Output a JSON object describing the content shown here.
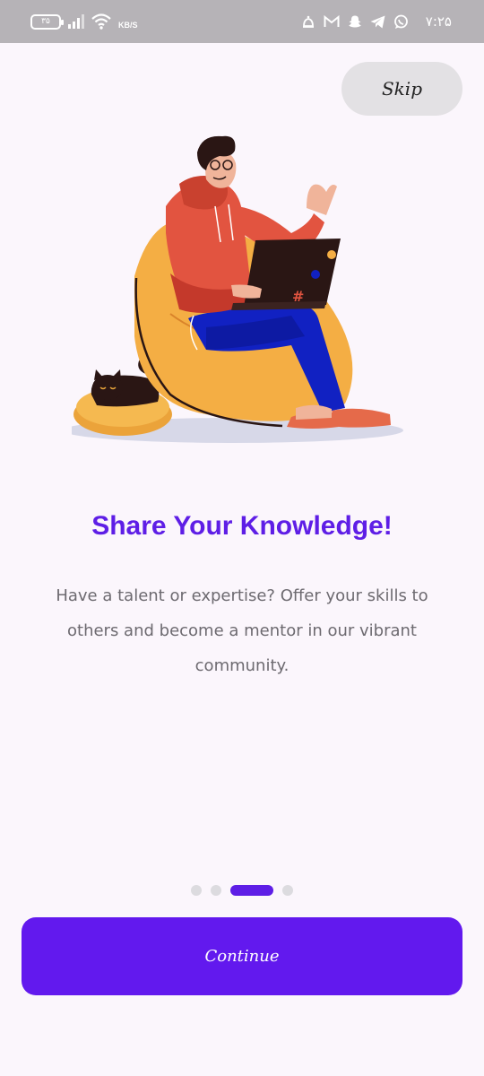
{
  "status_bar": {
    "battery_level": "۳۵",
    "net_speed": "KB/S",
    "time": "۷:۲۵",
    "icons": [
      "battery-icon",
      "signal-icon",
      "wifi-icon",
      "alarm-icon",
      "gmail-icon",
      "snapchat-icon",
      "telegram-icon",
      "whatsapp-icon"
    ]
  },
  "onboarding": {
    "skip_label": "Skip",
    "illustration": "person-with-laptop-on-beanbag-with-cat",
    "title": "Share Your Knowledge!",
    "description": "Have a talent or expertise? Offer your skills to others and become a mentor in our vibrant community.",
    "pager": {
      "total": 4,
      "active_index": 2
    },
    "continue_label": "Continue"
  },
  "colors": {
    "accent": "#5e1ee6",
    "button": "#6219ee",
    "background": "#fbf6fc",
    "status_bar": "#b6b3b7",
    "skip_bg": "#e3e1e4"
  }
}
